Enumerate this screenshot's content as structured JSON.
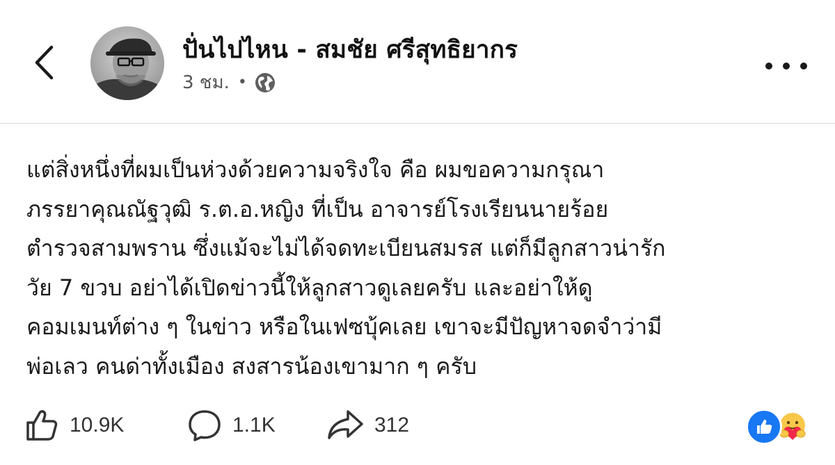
{
  "header": {
    "author_name": "ปั่นไปไหน - สมชัย ศรีสุทธิยากร",
    "timestamp": "3 ชม.",
    "separator": "•",
    "privacy_icon": "globe-icon",
    "back_icon": "chevron-left-icon",
    "more_icon": "more-horizontal-icon"
  },
  "post": {
    "lines": [
      "แต่สิ่งหนึ่งที่ผมเป็นห่วงด้วยความจริงใจ  คือ ผมขอความกรุณา",
      "ภรรยาคุณณัฐวุฒิ  ร.ต.อ.หญิง ที่เป็น  อาจารย์โรงเรียนนายร้อย",
      "ตำรวจสามพราน  ซึ่งแม้จะไม่ได้จดทะเบียนสมรส แต่ก็มีลูกสาวน่ารัก",
      "วัย 7 ขวบ  อย่าได้เปิดข่าวนี้ให้ลูกสาวดูเลยครับ  และอย่าให้ดู",
      "คอมเมนท์ต่าง ๆ ในข่าว หรือในเฟซบุ้คเลย  เขาจะมีปัญหาจดจำว่ามี",
      "พ่อเลว คนด่าทั้งเมือง  สงสารน้องเขามาก ๆ  ครับ"
    ]
  },
  "footer": {
    "likes": "10.9K",
    "comments": "1.1K",
    "shares": "312",
    "like_icon": "thumbs-up-icon",
    "comment_icon": "comment-bubble-icon",
    "share_icon": "share-arrow-icon",
    "reactions": [
      "like-reaction-icon",
      "care-reaction-icon"
    ]
  },
  "colors": {
    "like_blue": "#1877f2",
    "care_yellow": "#f7c84a",
    "care_heart": "#f0284a",
    "divider": "#d8d8d8"
  }
}
